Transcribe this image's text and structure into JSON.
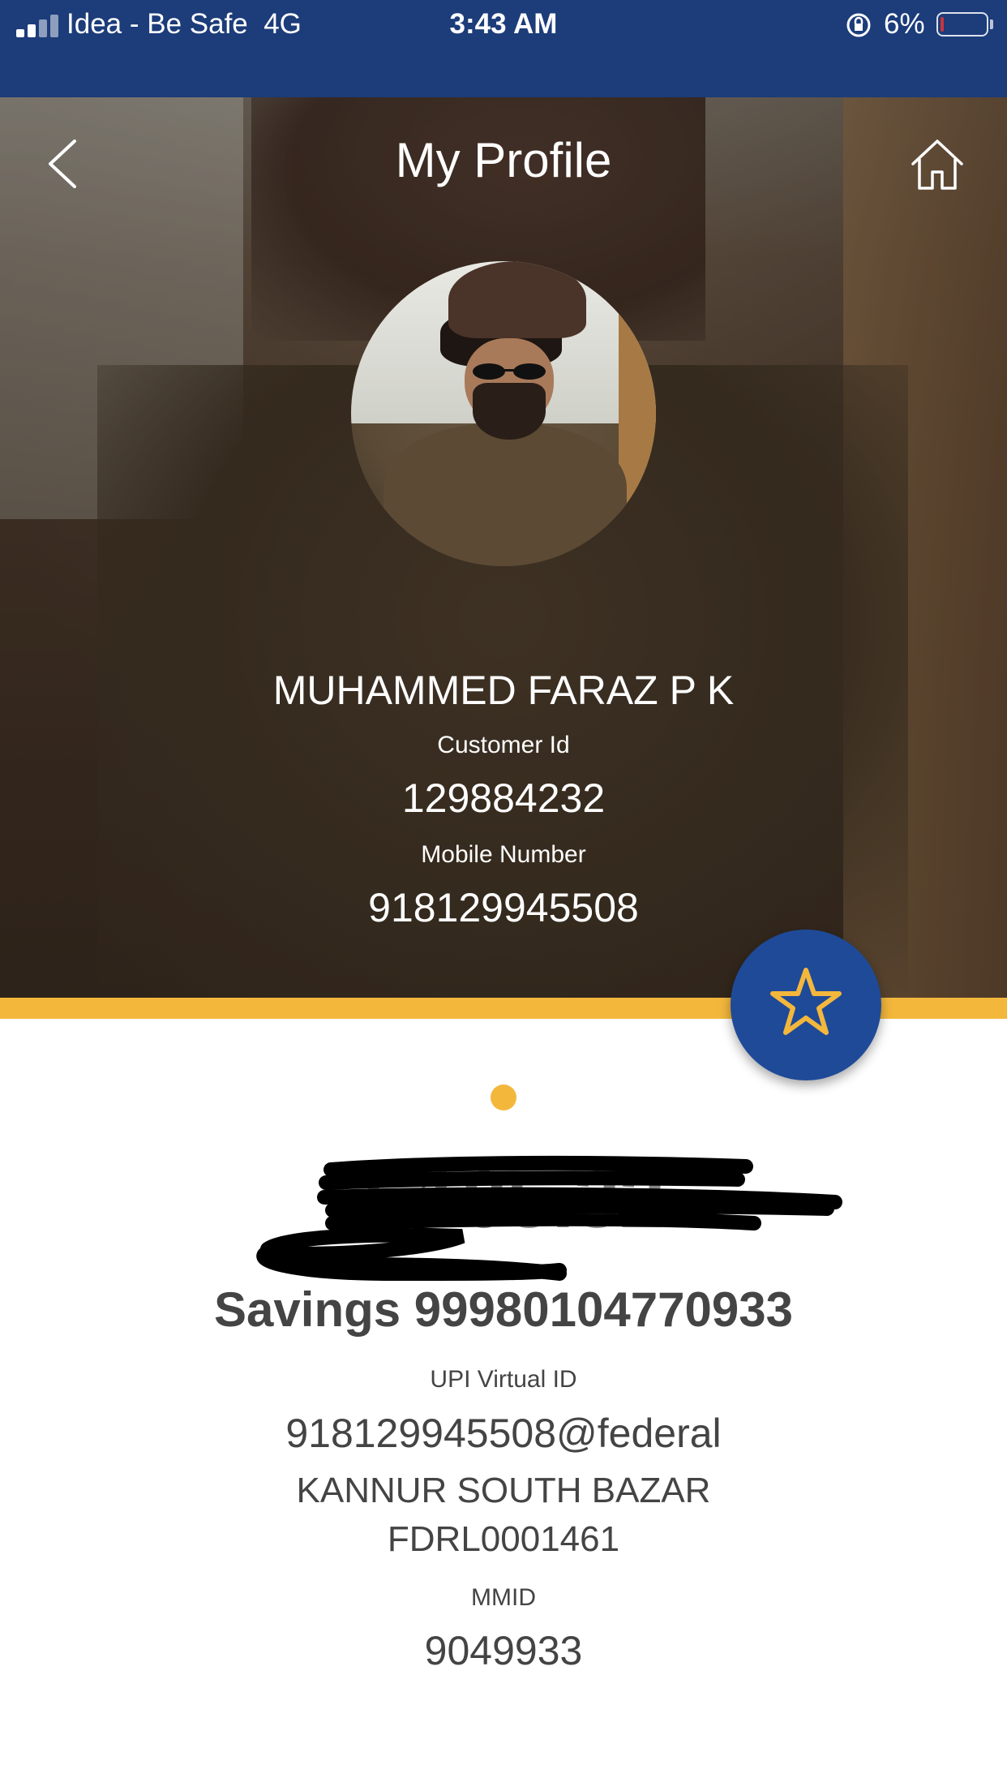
{
  "status_bar": {
    "carrier": "Idea - Be Safe",
    "network": "4G",
    "time": "3:43 AM",
    "battery": "6%",
    "icons": [
      "signal-icon",
      "rotation-lock-icon",
      "battery-icon"
    ]
  },
  "header": {
    "title": "My Profile",
    "back_icon": "chevron-left-icon",
    "home_icon": "home-icon"
  },
  "profile": {
    "name": "MUHAMMED FARAZ P K",
    "customer_id_label": "Customer Id",
    "customer_id": "129884232",
    "mobile_label": "Mobile Number",
    "mobile": "918129945508"
  },
  "favorite": {
    "icon": "star-icon"
  },
  "account": {
    "balance": "₹ 105.32",
    "title": "Savings 99980104770933",
    "upi_label": "UPI Virtual ID",
    "upi_id": "918129945508@federal",
    "branch": "KANNUR SOUTH BAZAR",
    "ifsc": "FDRL0001461",
    "mmid_label": "MMID",
    "mmid": "9049933"
  },
  "colors": {
    "status_bar": "#1c3c7a",
    "accent": "#f3b73c",
    "fab": "#1f4a98",
    "text_dark": "#444444"
  }
}
